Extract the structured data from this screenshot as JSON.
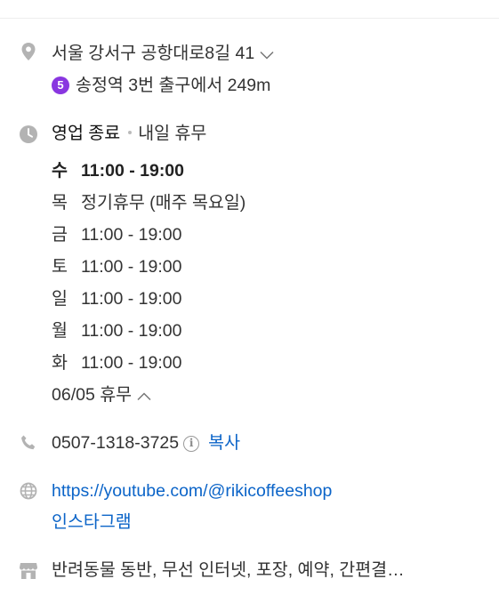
{
  "address": {
    "text": "서울 강서구 공항대로8길 41",
    "subway_line": "5",
    "subway_line_color": "#8936e0",
    "directions": "송정역 3번 출구에서 249m"
  },
  "hours": {
    "status": "영업 종료",
    "next": "내일 휴무",
    "days": [
      {
        "day": "수",
        "time": "11:00 - 19:00"
      },
      {
        "day": "목",
        "time": "정기휴무 (매주 목요일)"
      },
      {
        "day": "금",
        "time": "11:00 - 19:00"
      },
      {
        "day": "토",
        "time": "11:00 - 19:00"
      },
      {
        "day": "일",
        "time": "11:00 - 19:00"
      },
      {
        "day": "월",
        "time": "11:00 - 19:00"
      },
      {
        "day": "화",
        "time": "11:00 - 19:00"
      }
    ],
    "holiday_note": "06/05 휴무"
  },
  "phone": {
    "number": "0507-1318-3725",
    "info_icon_text": "i",
    "copy_label": "복사"
  },
  "links": {
    "youtube": "https://youtube.com/@rikicoffeeshop",
    "instagram": "인스타그램"
  },
  "amenities": {
    "text": "반려동물 동반, 무선 인터넷, 포장, 예약, 간편결…"
  },
  "colors": {
    "link": "#0b64c8",
    "icon": "#b3b3b3"
  }
}
